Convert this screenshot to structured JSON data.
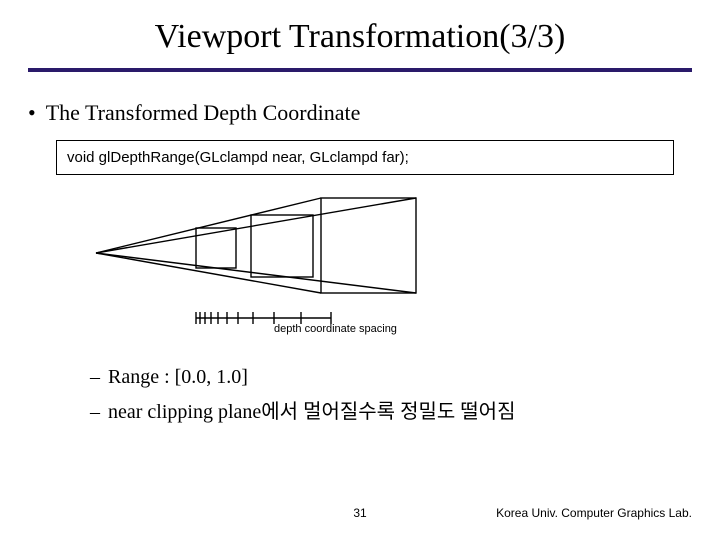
{
  "title": "Viewport Transformation(3/3)",
  "bullet_main": "The Transformed Depth Coordinate",
  "code_line": "void glDepthRange(GLclampd near, GLclampd far);",
  "figure_caption": "depth coordinate spacing",
  "sub_bullet_1": "Range : [0.0, 1.0]",
  "sub_bullet_2": "near clipping plane에서 멀어질수록 정밀도 떨어짐",
  "page_number": "31",
  "footer_lab": "Korea Univ. Computer Graphics Lab."
}
